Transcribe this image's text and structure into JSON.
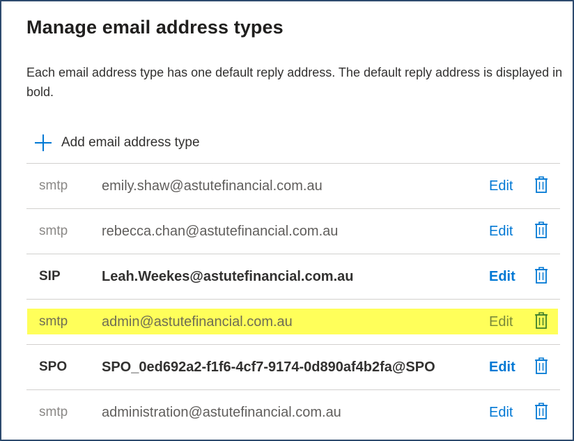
{
  "dialog": {
    "title": "Manage email address types",
    "description": "Each email address type has one default reply address. The default reply address is displayed in bold.",
    "add_label": "Add email address type",
    "edit_label": "Edit"
  },
  "addresses": [
    {
      "type": "smtp",
      "address": "emily.shaw@astutefinancial.com.au",
      "default": false,
      "highlighted": false
    },
    {
      "type": "smtp",
      "address": "rebecca.chan@astutefinancial.com.au",
      "default": false,
      "highlighted": false
    },
    {
      "type": "SIP",
      "address": "Leah.Weekes@astutefinancial.com.au",
      "default": true,
      "highlighted": false
    },
    {
      "type": "smtp",
      "address": "admin@astutefinancial.com.au",
      "default": false,
      "highlighted": true
    },
    {
      "type": "SPO",
      "address": "SPO_0ed692a2-f1f6-4cf7-9174-0d890af4b2fa@SPO",
      "default": true,
      "highlighted": false
    },
    {
      "type": "smtp",
      "address": "administration@astutefinancial.com.au",
      "default": false,
      "highlighted": false
    }
  ],
  "colors": {
    "accent": "#0078d4",
    "highlight": "#ffff5a",
    "frame_border": "#2d4a6e"
  },
  "icons": {
    "add": "plus-icon",
    "delete": "trash-icon"
  }
}
